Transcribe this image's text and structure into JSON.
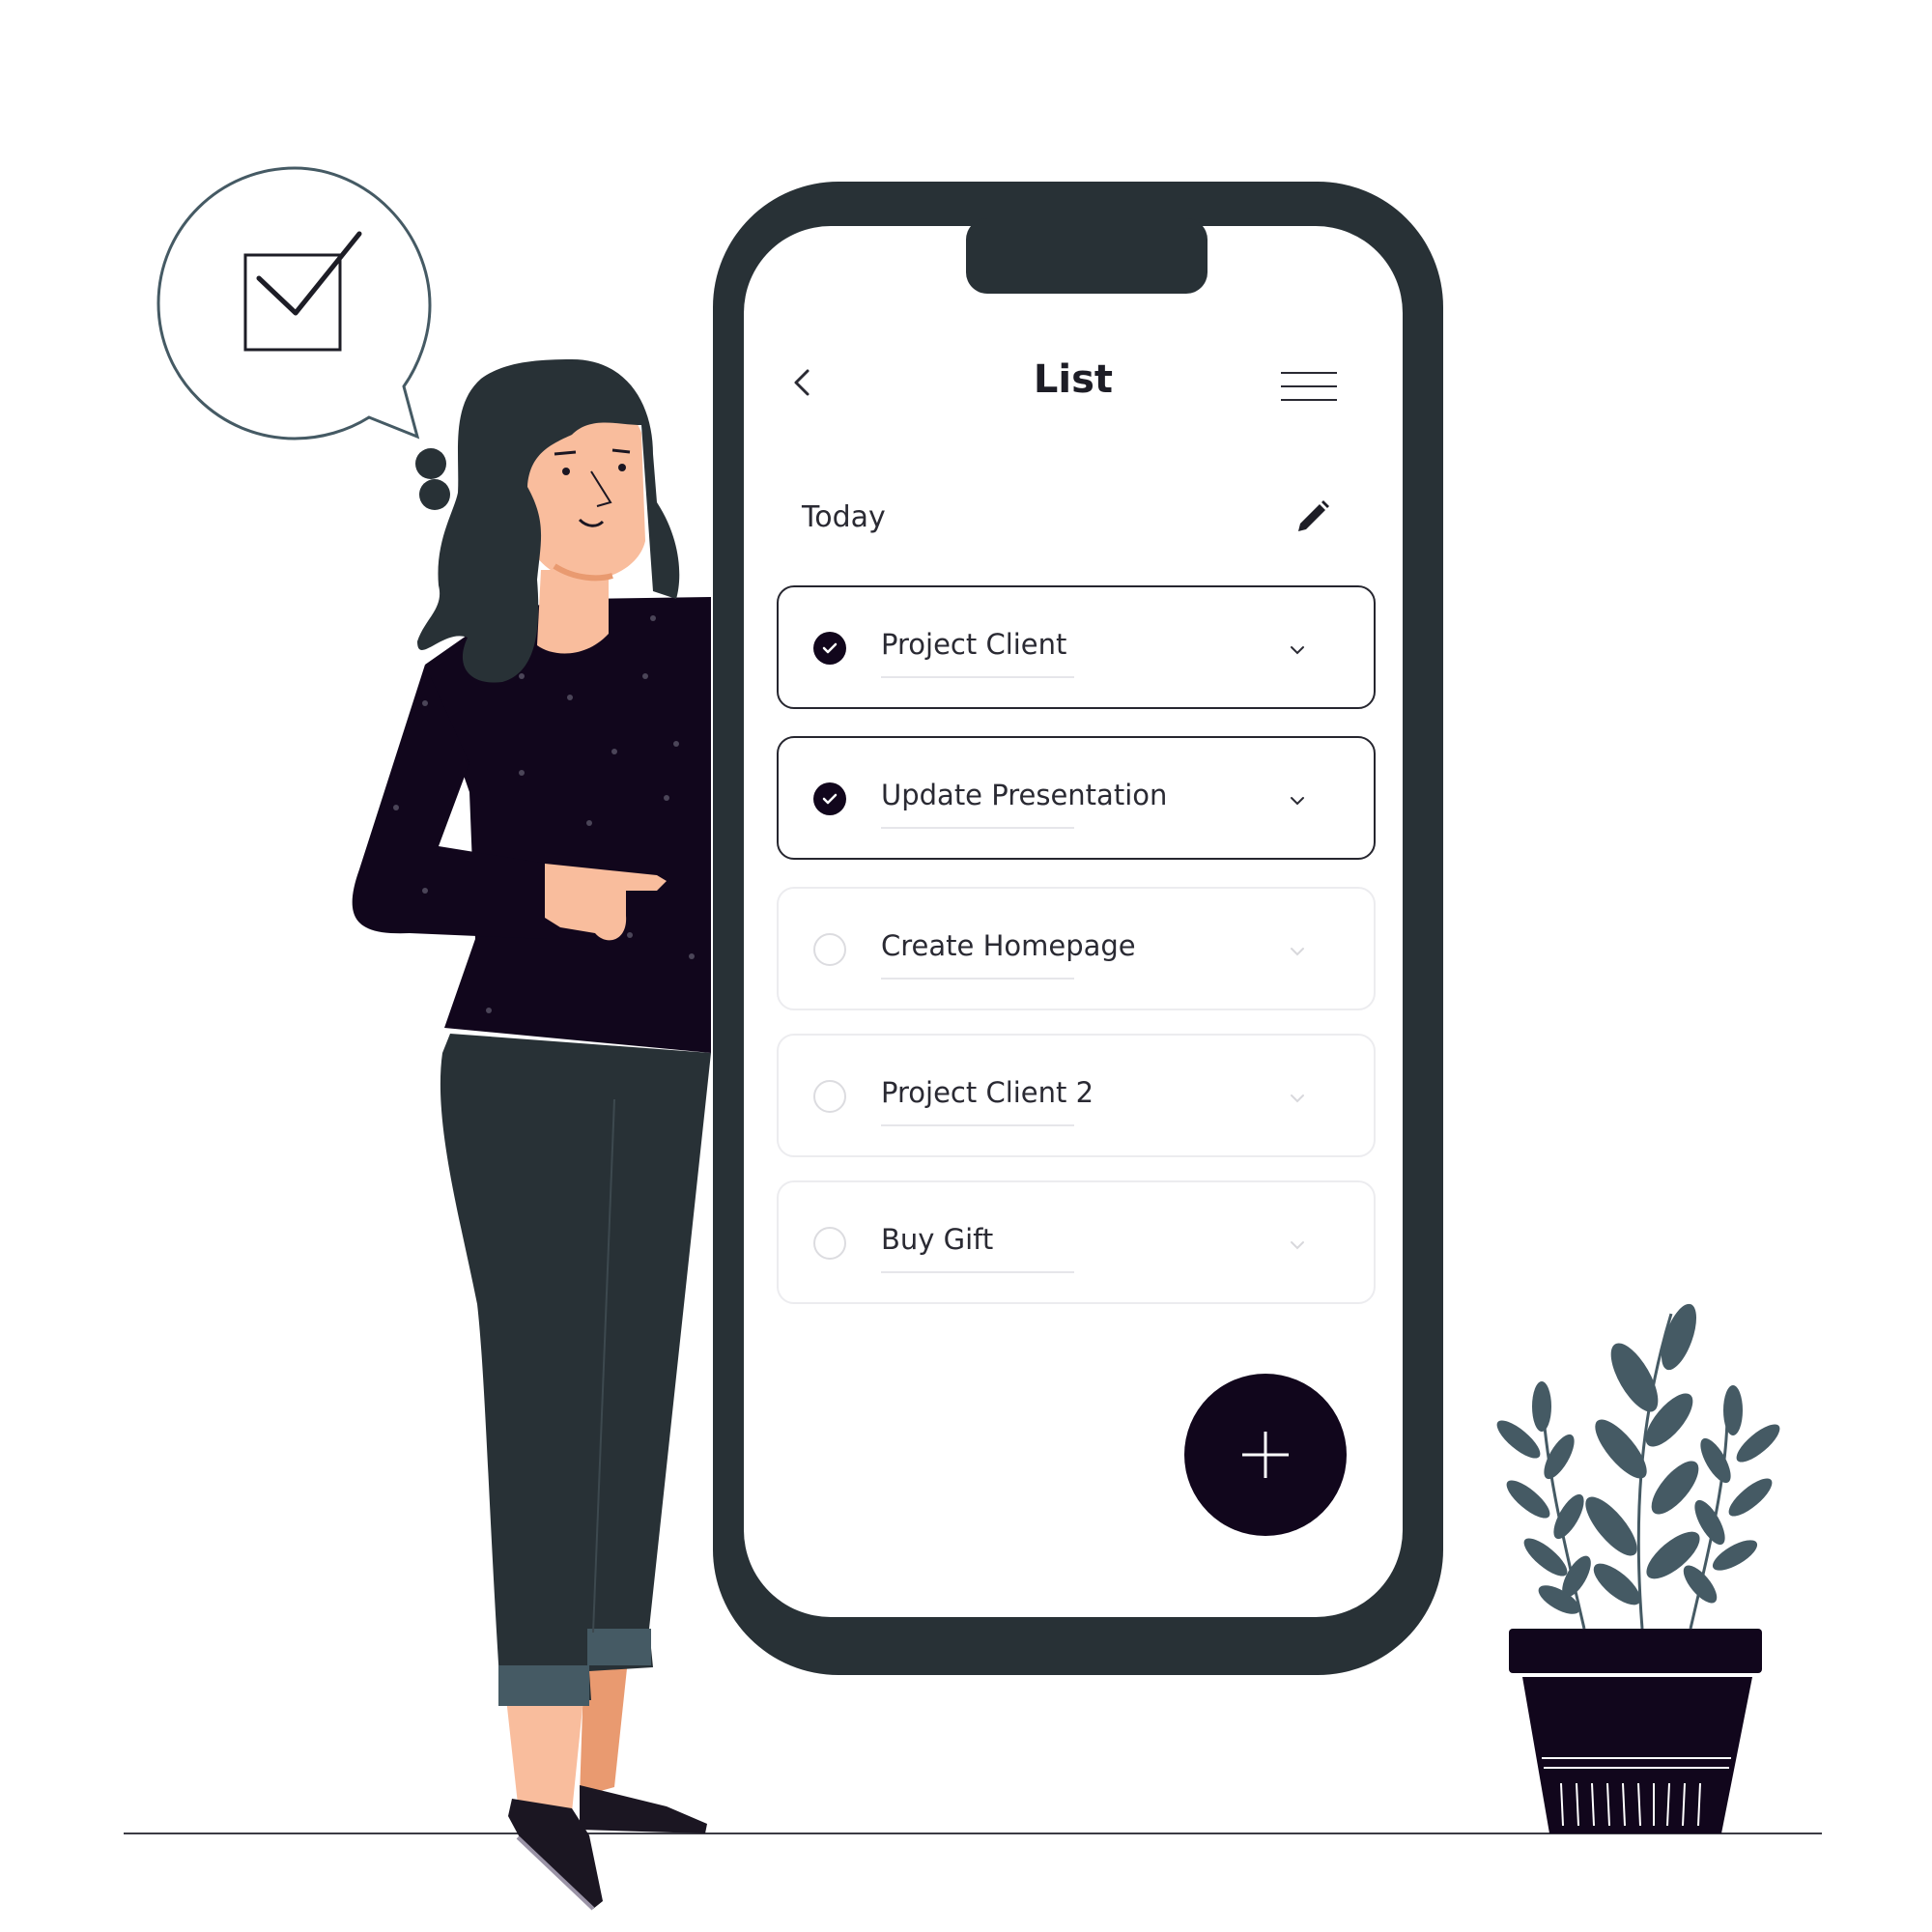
{
  "header": {
    "title": "List"
  },
  "section": {
    "title": "Today"
  },
  "tasks": [
    {
      "label": "Project Client",
      "done": true
    },
    {
      "label": "Update Presentation",
      "done": true
    },
    {
      "label": "Create Homepage",
      "done": false
    },
    {
      "label": "Project Client 2",
      "done": false
    },
    {
      "label": "Buy Gift",
      "done": false
    }
  ],
  "icons": {
    "back": "chevron-left-icon",
    "menu": "hamburger-menu-icon",
    "edit": "pencil-icon",
    "check": "checkmark-icon",
    "expand": "chevron-down-icon",
    "add": "plus-icon"
  },
  "colors": {
    "phone_frame": "#283136",
    "accent_dark": "#11061c",
    "skin": "#f9bd9d",
    "hair": "#283136",
    "plant_leaf": "#455a64"
  }
}
